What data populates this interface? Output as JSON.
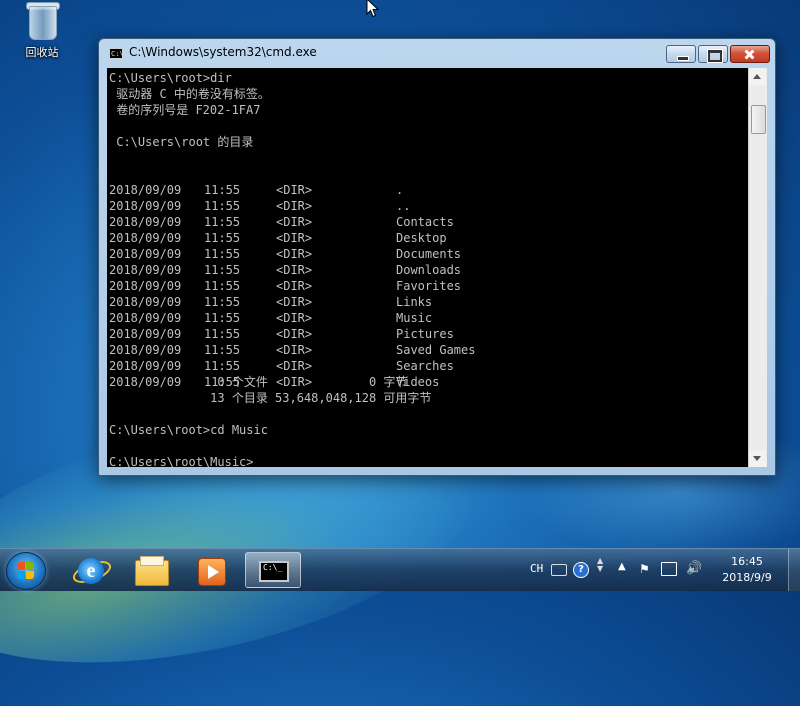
{
  "desktop": {
    "icons": [
      {
        "label": "回收站",
        "icon": "recycle-bin-icon"
      }
    ]
  },
  "window": {
    "title": "C:\\Windows\\system32\\cmd.exe",
    "app_icon_text": "C:\\",
    "controls": [
      "minimize",
      "maximize",
      "close"
    ]
  },
  "console": {
    "prompt_dir": "C:\\Users\\root>dir",
    "volume_line1": " 驱动器 C 中的卷没有标签。",
    "volume_line2": " 卷的序列号是 F202-1FA7",
    "dir_of": " C:\\Users\\root 的目录",
    "entries": [
      {
        "date": "2018/09/09",
        "time": "11:55",
        "type": "<DIR>",
        "name": "."
      },
      {
        "date": "2018/09/09",
        "time": "11:55",
        "type": "<DIR>",
        "name": ".."
      },
      {
        "date": "2018/09/09",
        "time": "11:55",
        "type": "<DIR>",
        "name": "Contacts"
      },
      {
        "date": "2018/09/09",
        "time": "11:55",
        "type": "<DIR>",
        "name": "Desktop"
      },
      {
        "date": "2018/09/09",
        "time": "11:55",
        "type": "<DIR>",
        "name": "Documents"
      },
      {
        "date": "2018/09/09",
        "time": "11:55",
        "type": "<DIR>",
        "name": "Downloads"
      },
      {
        "date": "2018/09/09",
        "time": "11:55",
        "type": "<DIR>",
        "name": "Favorites"
      },
      {
        "date": "2018/09/09",
        "time": "11:55",
        "type": "<DIR>",
        "name": "Links"
      },
      {
        "date": "2018/09/09",
        "time": "11:55",
        "type": "<DIR>",
        "name": "Music"
      },
      {
        "date": "2018/09/09",
        "time": "11:55",
        "type": "<DIR>",
        "name": "Pictures"
      },
      {
        "date": "2018/09/09",
        "time": "11:55",
        "type": "<DIR>",
        "name": "Saved Games"
      },
      {
        "date": "2018/09/09",
        "time": "11:55",
        "type": "<DIR>",
        "name": "Searches"
      },
      {
        "date": "2018/09/09",
        "time": "11:55",
        "type": "<DIR>",
        "name": "Videos"
      }
    ],
    "summary_files": "               0 个文件              0 字节",
    "summary_dirs": "              13 个目录 53,648,048,128 可用字节",
    "prompt_cd": "C:\\Users\\root>cd Music",
    "prompt_current": "C:\\Users\\root\\Music>"
  },
  "taskbar": {
    "apps": [
      {
        "name": "internet-explorer",
        "icon": "ie-icon",
        "glyph": "e"
      },
      {
        "name": "windows-explorer",
        "icon": "folder-icon"
      },
      {
        "name": "windows-media-player",
        "icon": "media-player-icon"
      },
      {
        "name": "command-prompt",
        "icon": "cmd-icon",
        "glyph": "C:\\_",
        "active": true
      }
    ],
    "tray": {
      "language": "CH",
      "help_glyph": "?",
      "show_hidden": "▲",
      "flag_glyph": "⚑",
      "volume_glyph": "🔊",
      "time": "16:45",
      "date": "2018/9/9"
    }
  }
}
